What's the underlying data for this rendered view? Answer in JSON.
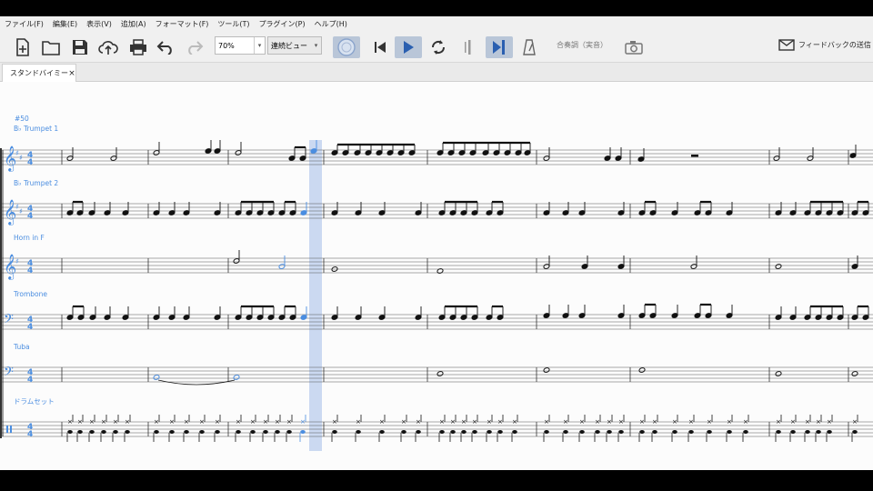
{
  "menu": [
    {
      "label": "ファイル(F)"
    },
    {
      "label": "編集(E)"
    },
    {
      "label": "表示(V)"
    },
    {
      "label": "追加(A)"
    },
    {
      "label": "フォーマット(F)"
    },
    {
      "label": "ツール(T)"
    },
    {
      "label": "プラグイン(P)"
    },
    {
      "label": "ヘルプ(H)"
    }
  ],
  "toolbar": {
    "zoom": "70%",
    "view_mode": "連続ビュー",
    "concert_pitch": "合奏調（実音）",
    "feedback": "フィードバックの送信"
  },
  "tab": {
    "title": "スタンドバイミー",
    "close": "×"
  },
  "score": {
    "rehearsal": "#50",
    "instruments": [
      {
        "name": "B♭ Trumpet 1",
        "clef": "treble",
        "key_sharps": 2
      },
      {
        "name": "B♭ Trumpet 2",
        "clef": "treble",
        "key_sharps": 2
      },
      {
        "name": "Horn in F",
        "clef": "treble",
        "key_sharps": 1
      },
      {
        "name": "Trombone",
        "clef": "bass",
        "key_sharps": 0
      },
      {
        "name": "Tuba",
        "clef": "bass",
        "key_sharps": 0
      },
      {
        "name": "ドラムセット",
        "clef": "percussion",
        "key_sharps": 0
      }
    ],
    "time_signature": {
      "top": "4",
      "bottom": "4"
    }
  },
  "colors": {
    "accent": "#4a8de0",
    "selection": "#c5d5f0",
    "toolbar_pressed": "#b9c6d8"
  }
}
